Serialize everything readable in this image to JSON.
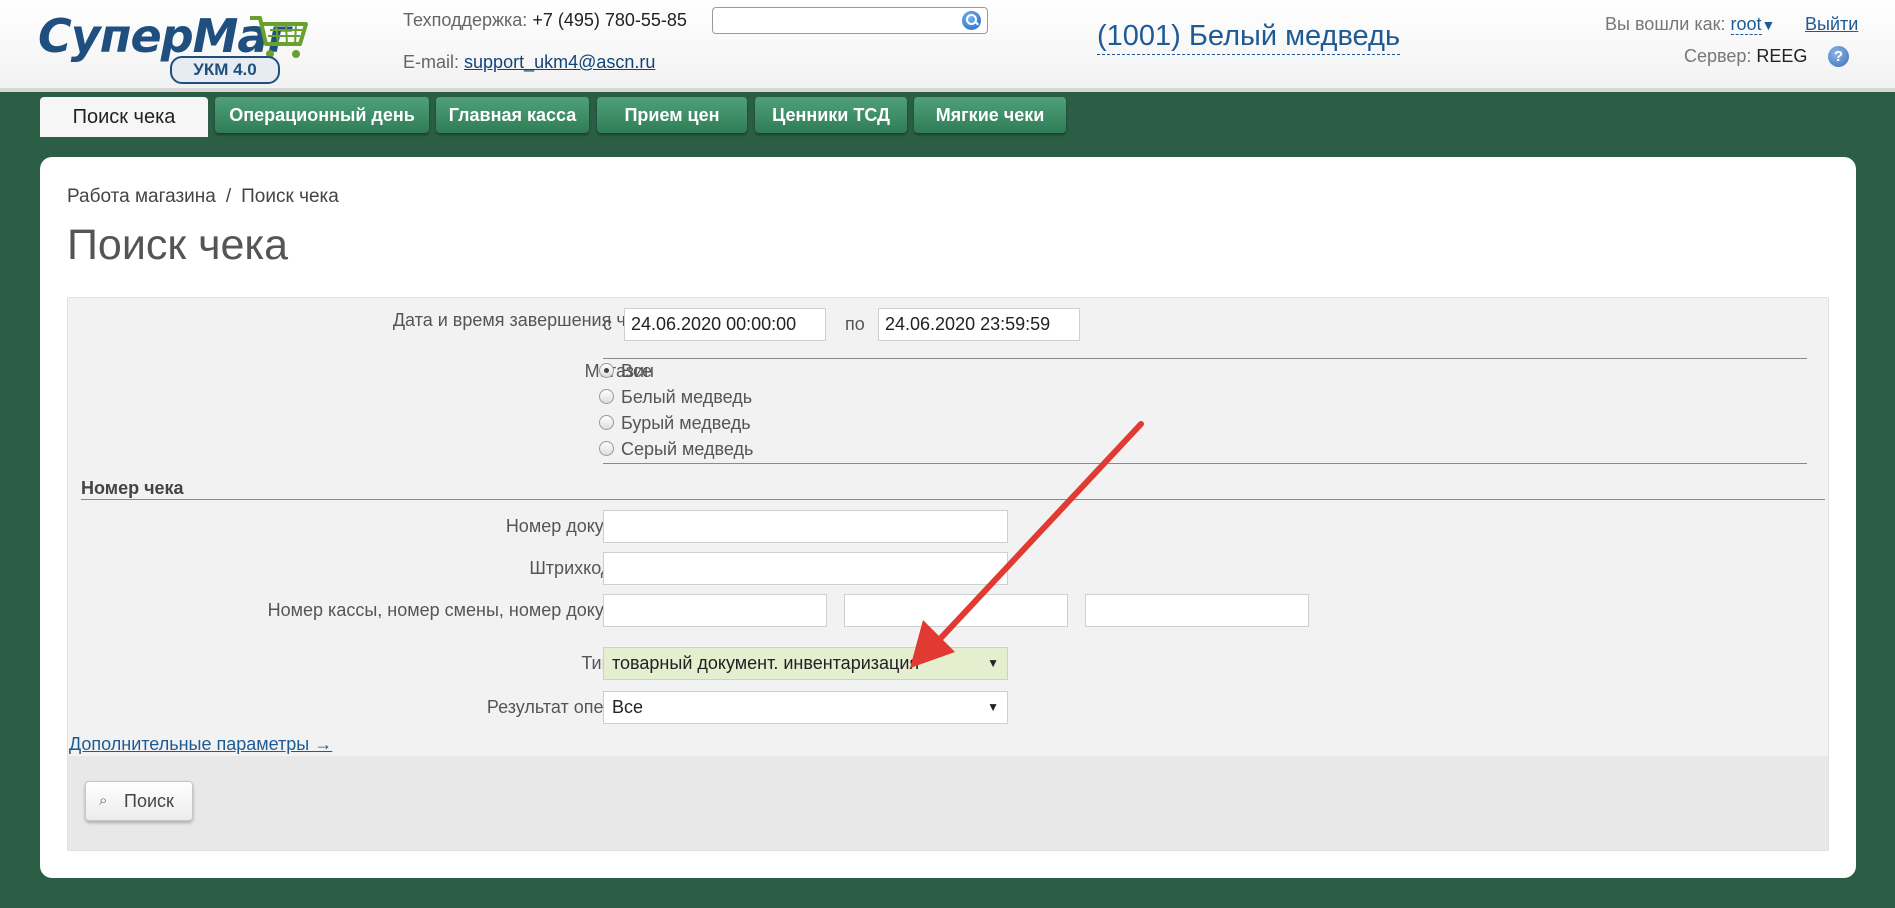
{
  "header": {
    "logo": {
      "brand_a": "Супер",
      "brand_b": "Маг",
      "badge": "УКМ 4.0"
    },
    "support": {
      "phone_label": "Техподдержка:",
      "phone": "+7 (495) 780-55-85",
      "email_label": "E-mail:",
      "email": "support_ukm4@ascn.ru"
    },
    "search": {
      "value": ""
    },
    "store_title": "(1001) Белый медведь",
    "user": {
      "label": "Вы вошли как:",
      "name": "root",
      "logout": "Выйти"
    },
    "server": {
      "label": "Сервер:",
      "name": "REEG"
    },
    "help": "?"
  },
  "tabs": [
    {
      "label": "Поиск чека",
      "active": true
    },
    {
      "label": "Операционный день",
      "active": false
    },
    {
      "label": "Главная касса",
      "active": false
    },
    {
      "label": "Прием цен",
      "active": false
    },
    {
      "label": "Ценники ТСД",
      "active": false
    },
    {
      "label": "Мягкие чеки",
      "active": false
    }
  ],
  "breadcrumb": {
    "parent": "Работа магазина",
    "separator": "/",
    "current": "Поиск чека"
  },
  "page_title": "Поиск чека",
  "form": {
    "datetime": {
      "label": "Дата и время завершения чека",
      "from_label": "с",
      "from_value": "24.06.2020 00:00:00",
      "to_label": "по",
      "to_value": "24.06.2020 23:59:59"
    },
    "store": {
      "label": "Магазин",
      "options": [
        {
          "label": "Все",
          "checked": true
        },
        {
          "label": "Белый медведь",
          "checked": false
        },
        {
          "label": "Бурый медведь",
          "checked": false
        },
        {
          "label": "Серый медведь",
          "checked": false
        }
      ]
    },
    "receipt_section_title": "Номер чека",
    "document_number": {
      "label": "Номер документа",
      "value": ""
    },
    "barcode": {
      "label": "Штрихкод чека",
      "value": ""
    },
    "kkm_shift_doc": {
      "label": "Номер кассы, номер смены, номер документа",
      "values": [
        "",
        "",
        ""
      ]
    },
    "receipt_type": {
      "label": "Тип чека",
      "value": "товарный документ. инвентаризация"
    },
    "operation_result": {
      "label": "Результат операции",
      "value": "Все"
    },
    "more_params_link": "Дополнительные параметры →",
    "search_button": "Поиск"
  },
  "annotation": {
    "color": "#e03a32"
  }
}
